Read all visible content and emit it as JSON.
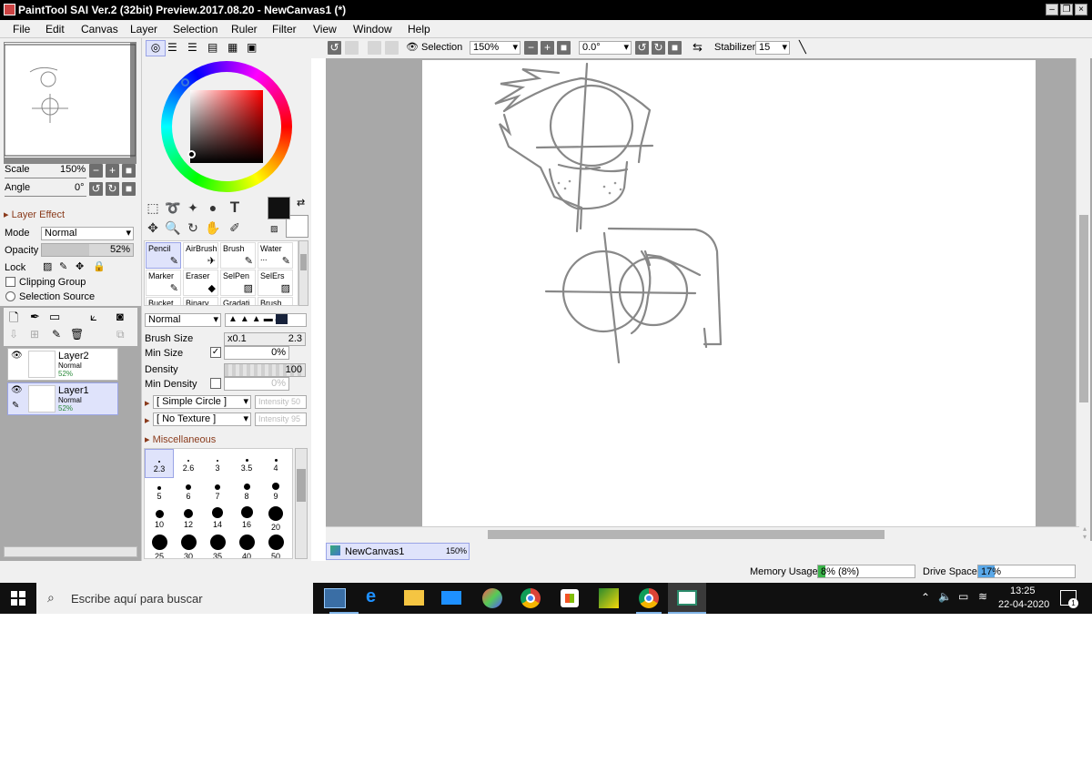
{
  "window": {
    "title": "PaintTool SAI Ver.2 (32bit) Preview.2017.08.20 - NewCanvas1 (*)"
  },
  "menu": [
    "File",
    "Edit",
    "Canvas",
    "Layer",
    "Selection",
    "Ruler",
    "Filter",
    "View",
    "Window",
    "Help"
  ],
  "navigator": {
    "scale_label": "Scale",
    "scale_value": "150%",
    "angle_label": "Angle",
    "angle_value": "0°"
  },
  "layer_effect": {
    "header": "Layer Effect",
    "mode_label": "Mode",
    "mode_value": "Normal",
    "opacity_label": "Opacity",
    "opacity_value": "52%",
    "opacity_fraction": 0.52,
    "lock_label": "Lock",
    "clipping_group": "Clipping Group",
    "selection_source": "Selection Source"
  },
  "layers": [
    {
      "name": "Layer2",
      "mode": "Normal",
      "opacity": "52%",
      "selected": false
    },
    {
      "name": "Layer1",
      "mode": "Normal",
      "opacity": "52%",
      "selected": true
    }
  ],
  "brush_tools": [
    {
      "label": "Pencil",
      "selected": true
    },
    {
      "label": "AirBrush"
    },
    {
      "label": "Brush"
    },
    {
      "label": "Water ..."
    },
    {
      "label": "Marker"
    },
    {
      "label": "Eraser"
    },
    {
      "label": "SelPen"
    },
    {
      "label": "SelErs"
    },
    {
      "label": "Bucket"
    },
    {
      "label": "Binary ..."
    },
    {
      "label": "Gradati..."
    },
    {
      "label": "Brush"
    }
  ],
  "brush_settings": {
    "blend_mode": "Normal",
    "brush_size_label": "Brush Size",
    "brush_size_mult": "x0.1",
    "brush_size_value": "2.3",
    "min_size_label": "Min Size",
    "min_size_value": "0%",
    "density_label": "Density",
    "density_value": "100",
    "min_density_label": "Min Density",
    "min_density_value": "0%",
    "shape": "[ Simple Circle ]",
    "shape_intensity": "Intensity 50",
    "texture": "[ No Texture ]",
    "texture_intensity": "Intensity 95",
    "misc_label": "Miscellaneous"
  },
  "brush_sizes": [
    "2.3",
    "2.6",
    "3",
    "3.5",
    "4",
    "5",
    "6",
    "7",
    "8",
    "9",
    "10",
    "12",
    "14",
    "16",
    "20",
    "25",
    "30",
    "35",
    "40",
    "50"
  ],
  "toolbar": {
    "selection_label": "Selection",
    "zoom_value": "150%",
    "angle_value": "0.0°",
    "stabilizer_label": "Stabilizer",
    "stabilizer_value": "15"
  },
  "canvas_tab": {
    "name": "NewCanvas1",
    "zoom": "150%"
  },
  "status": {
    "memory_label": "Memory Usage",
    "memory_value": "8% (8%)",
    "memory_fraction": 0.08,
    "drive_label": "Drive Space",
    "drive_value": "17%",
    "drive_fraction": 0.17
  },
  "taskbar": {
    "search_placeholder": "Escribe aquí para buscar",
    "time": "13:25",
    "date": "22-04-2020",
    "notification_count": "1"
  },
  "colors": {
    "accent": "#9aa4e6",
    "titlebar": "#000000",
    "canvas_bg": "#a8a8a8",
    "selected_row": "#dfe3fb",
    "primary_color": "#111111",
    "secondary_color": "#ffffff"
  }
}
